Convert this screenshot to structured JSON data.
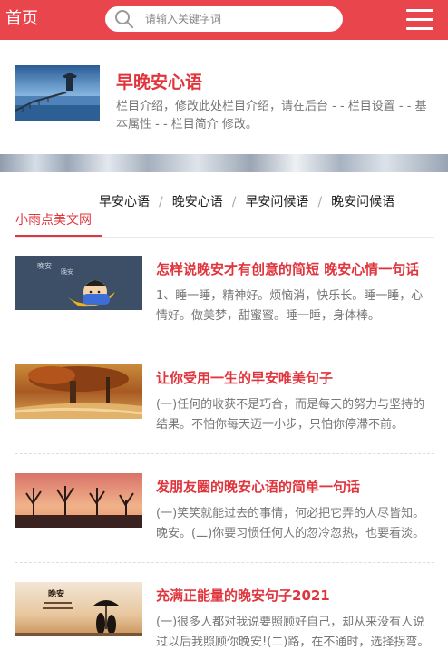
{
  "header": {
    "home_label": "首页",
    "search_placeholder": "请输入关键字词",
    "search_icon": "search-icon",
    "menu_icon": "hamburger-menu-icon",
    "accent_color": "#e8454c"
  },
  "intro": {
    "title": "早晚安心语",
    "description": "栏目介绍，修改此处栏目介绍，请在后台 - - 栏目设置 - - 基本属性 - - 栏目简介 修改。"
  },
  "breadcrumb": {
    "items": [
      "早安心语",
      "晚安心语",
      "早安问候语",
      "晚安问候语"
    ],
    "site_name": "小雨点美文网"
  },
  "articles": [
    {
      "title": "怎样说晚安才有创意的简短 晚安心情一句话",
      "excerpt": "1、睡一睡，精神好。烦恼消，快乐长。睡一睡，心情好。做美梦，甜蜜蜜。睡一睡，身体棒。"
    },
    {
      "title": "让你受用一生的早安唯美句子",
      "excerpt": "(一)任何的收获不是巧合，而是每天的努力与坚持的结果。不怕你每天迈一小步，只怕你停滞不前。"
    },
    {
      "title": "发朋友圈的晚安心语的简单一句话",
      "excerpt": "(一)笑笑就能过去的事情，何必把它弄的人尽皆知。晚安。(二)你要习惯任何人的忽冷忽热，也要看淡。"
    },
    {
      "title": "充满正能量的晚安句子2021",
      "excerpt": "(一)很多人都对我说要照顾好自己，却从来没有人说过以后我照顾你晚安!(二)路，在不通时，选择拐弯。"
    }
  ]
}
